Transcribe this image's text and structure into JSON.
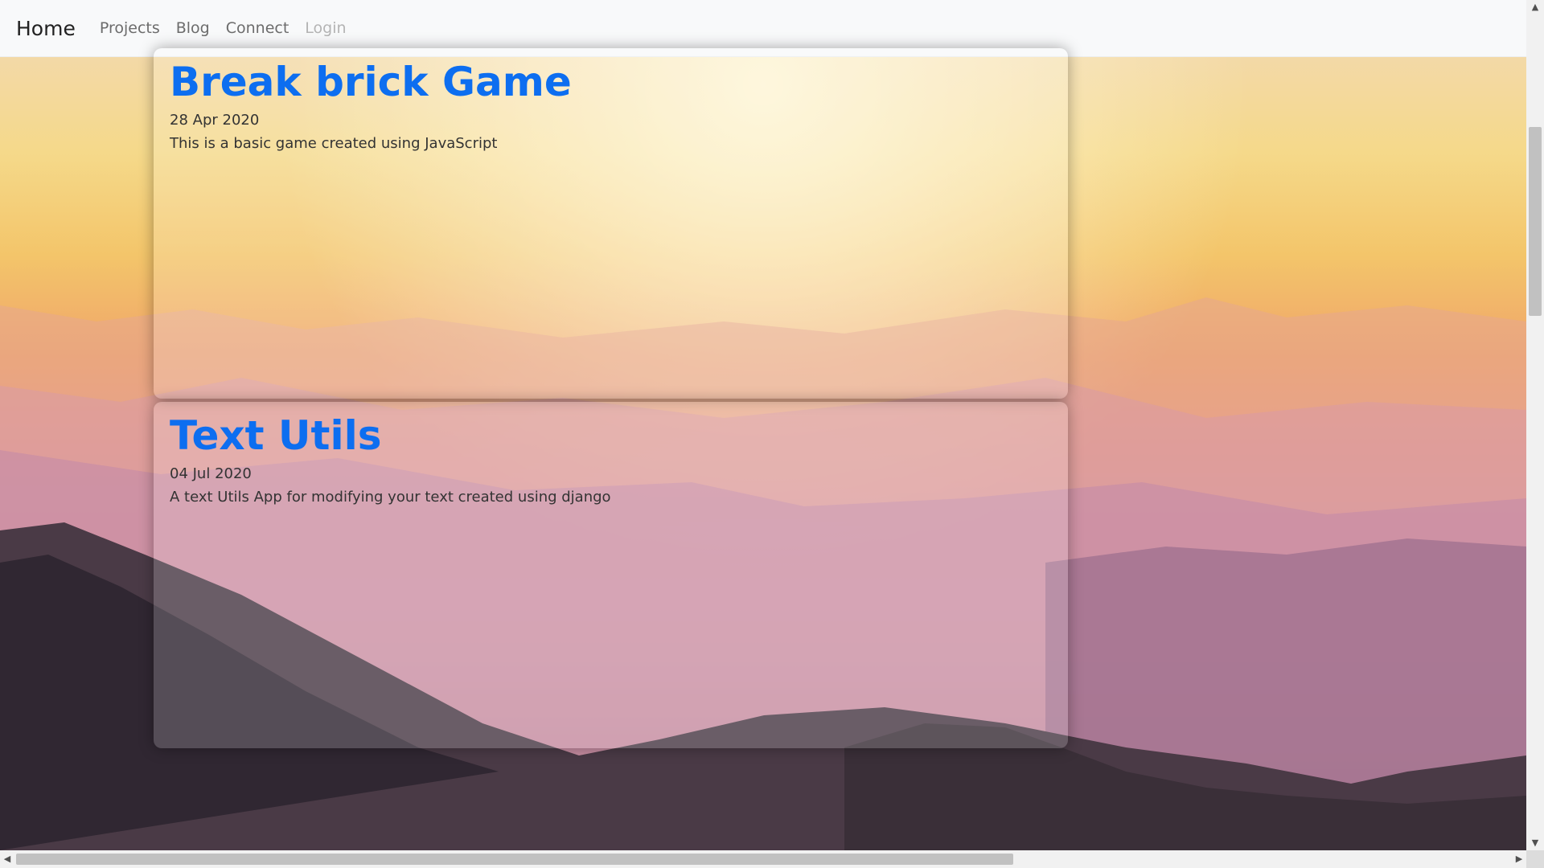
{
  "navbar": {
    "brand": "Home",
    "items": [
      {
        "label": "Projects",
        "state": "active"
      },
      {
        "label": "Blog",
        "state": "active"
      },
      {
        "label": "Connect",
        "state": "active"
      },
      {
        "label": "Login",
        "state": "disabled"
      }
    ]
  },
  "projects": [
    {
      "title": "Break brick Game",
      "date": "28 Apr 2020",
      "description": "This is a basic game created using JavaScript"
    },
    {
      "title": "Text Utils",
      "date": "04 Jul 2020",
      "description": "A text Utils App for modifying your text created using django"
    }
  ],
  "colors": {
    "title_link": "#0d6ef0",
    "navbar_bg": "#f8f9fa"
  },
  "icons": {
    "scroll_up": "triangle-up",
    "scroll_down": "triangle-down",
    "scroll_left": "triangle-left",
    "scroll_right": "triangle-right"
  }
}
